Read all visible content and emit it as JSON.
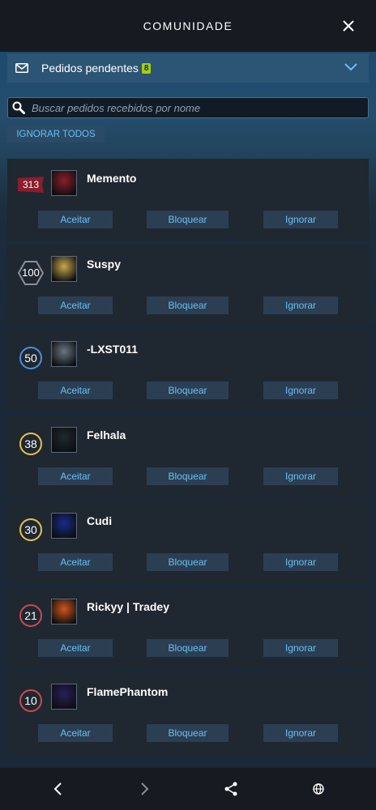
{
  "header": {
    "title": "COMUNIDADE",
    "close_icon": "close-icon"
  },
  "pending": {
    "label": "Pedidos pendentes",
    "count": "8"
  },
  "search": {
    "placeholder": "Buscar pedidos recebidos por nome"
  },
  "ignore_all_label": "IGNORAR TODOS",
  "buttons": {
    "accept": "Aceitar",
    "block": "Bloquear",
    "ignore": "Ignorar"
  },
  "requests": [
    {
      "name": "Memento",
      "level": "313",
      "level_style": "flag",
      "avatar_color": "#8b1e2a"
    },
    {
      "name": "Suspy",
      "level": "100",
      "level_style": "hex",
      "avatar_color": "#c9a84a"
    },
    {
      "name": "-LXST011",
      "level": "50",
      "level_style": "blue",
      "avatar_color": "#6b7680"
    },
    {
      "name": "Felhala",
      "level": "38",
      "level_style": "gold",
      "avatar_color": "#1f2a2e"
    },
    {
      "name": "Cudi",
      "level": "30",
      "level_style": "gold",
      "avatar_color": "#1a2a8a"
    },
    {
      "name": "Rickyy | Tradey",
      "level": "21",
      "level_style": "red",
      "avatar_color": "#d2551a"
    },
    {
      "name": "FlamePhantom",
      "level": "10",
      "level_style": "red",
      "avatar_color": "#2a1f5a"
    }
  ],
  "bottom_nav": [
    "back-icon",
    "forward-icon",
    "share-icon",
    "globe-icon"
  ],
  "colors": {
    "accent": "#67c1f5",
    "badge": "#a4d007",
    "bg": "#1b2838"
  }
}
